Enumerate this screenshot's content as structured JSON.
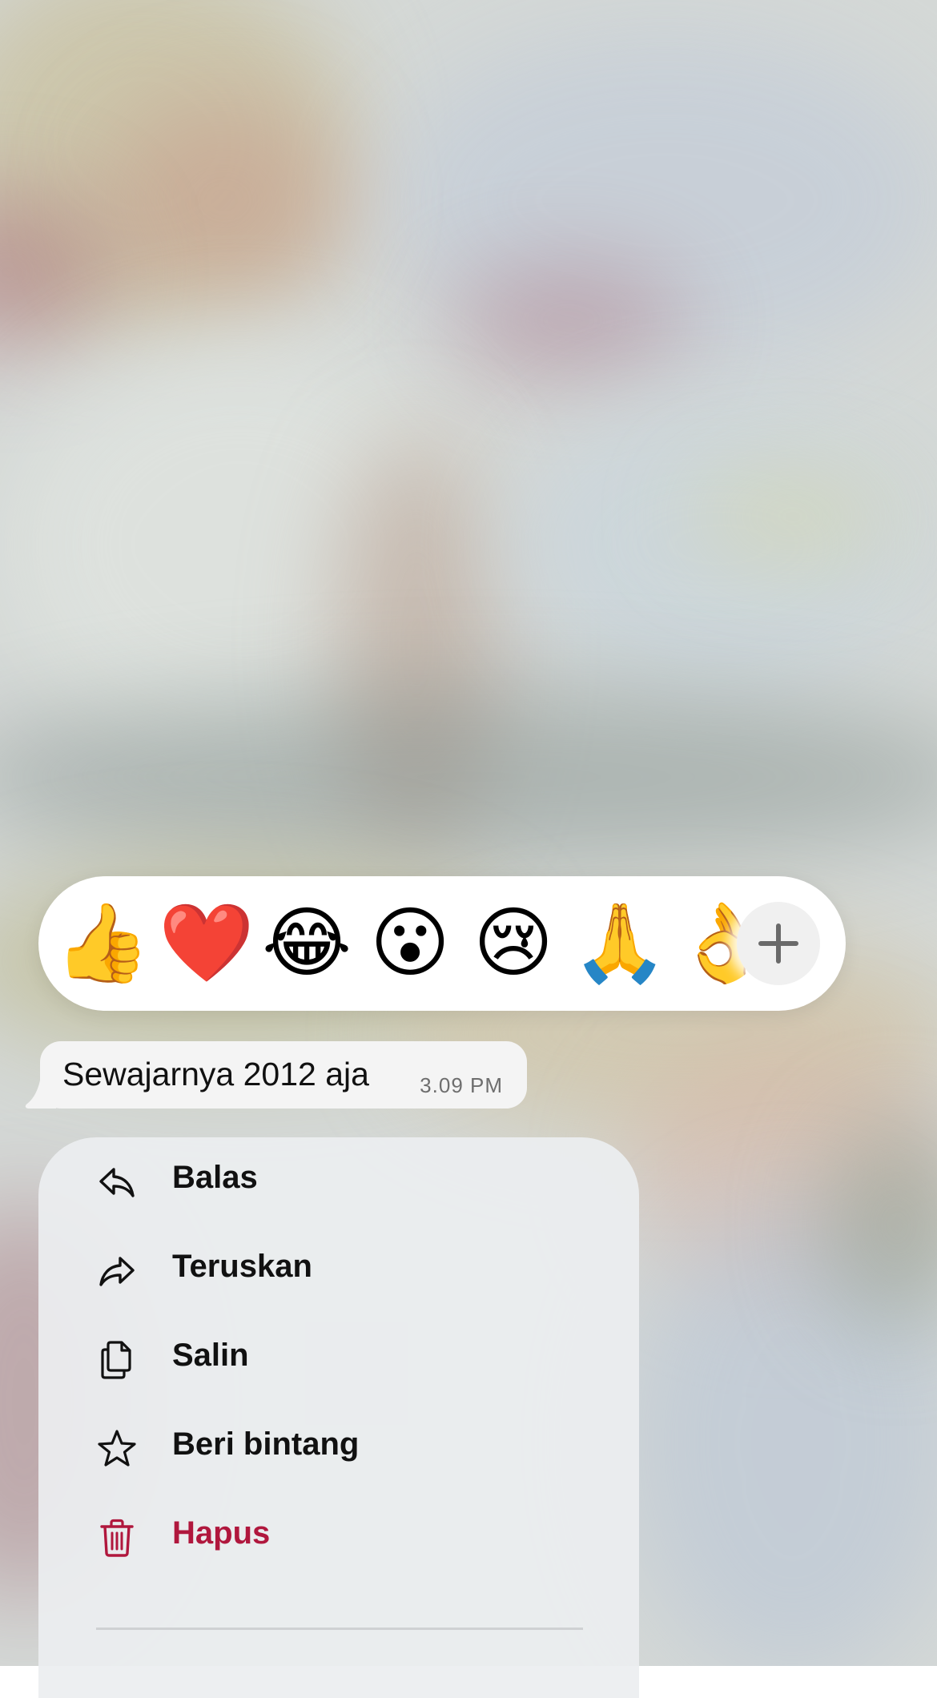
{
  "reactions": {
    "emojis": [
      "👍",
      "❤️",
      "😂",
      "😮",
      "😢",
      "🙏",
      "👌"
    ],
    "more_icon": "plus-icon"
  },
  "message": {
    "text": "Sewajarnya 2012 aja",
    "time": "3.09 PM"
  },
  "menu": {
    "items": [
      {
        "label": "Balas",
        "icon": "reply-icon"
      },
      {
        "label": "Teruskan",
        "icon": "forward-icon"
      },
      {
        "label": "Salin",
        "icon": "copy-icon"
      },
      {
        "label": "Beri bintang",
        "icon": "star-icon"
      },
      {
        "label": "Hapus",
        "icon": "trash-icon",
        "color": "#b0173d"
      }
    ]
  }
}
